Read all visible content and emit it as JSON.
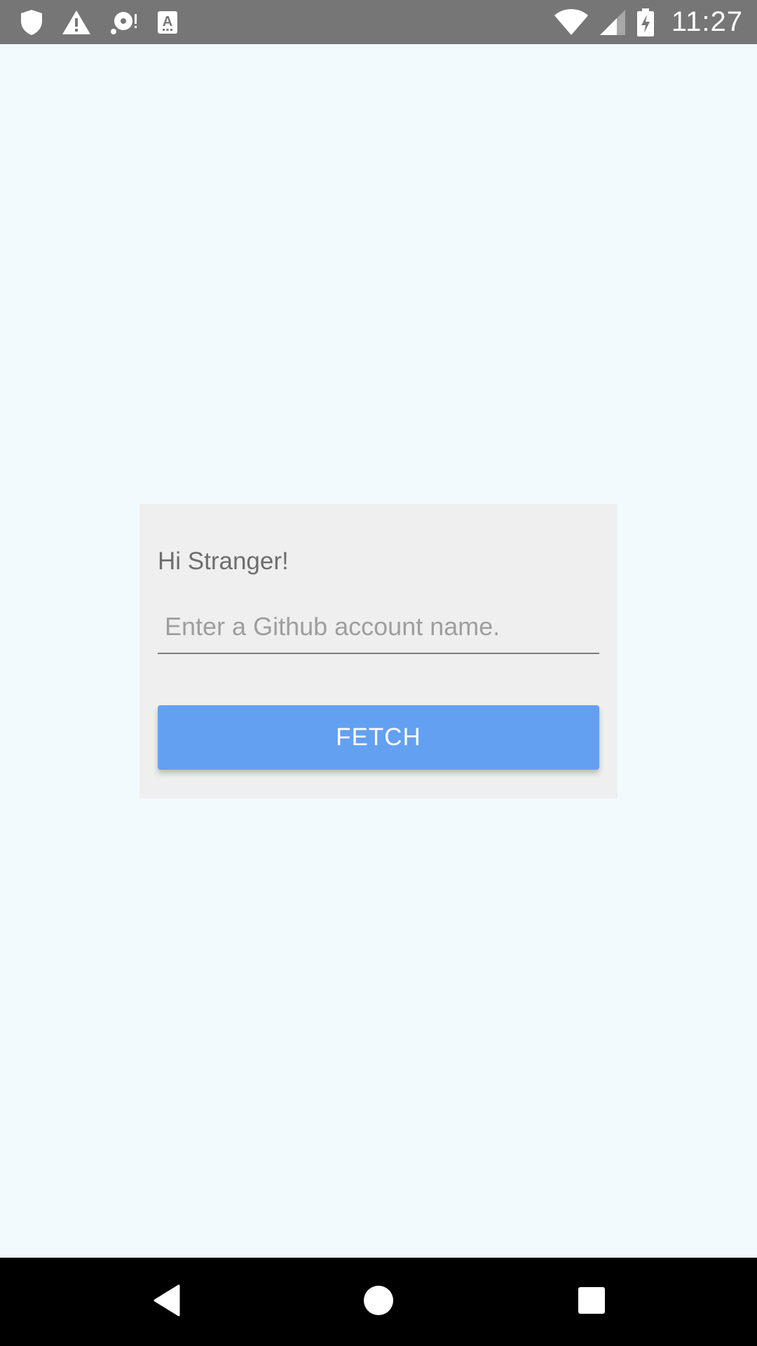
{
  "status_bar": {
    "time": "11:27",
    "left_icons": [
      "shield-icon",
      "warning-icon",
      "media-notification-icon",
      "keyboard-a-icon"
    ],
    "right_icons": [
      "wifi-icon",
      "cellular-signal-icon",
      "battery-charging-icon"
    ]
  },
  "card": {
    "greeting": "Hi Stranger!",
    "input_placeholder": "Enter a Github account name.",
    "input_value": "",
    "button_label": "FETCH"
  },
  "nav_bar": {
    "buttons": [
      "back-icon",
      "home-icon",
      "recents-icon"
    ]
  },
  "colors": {
    "status_bar": "#767676",
    "background": "#f2fafe",
    "card": "#efefef",
    "button": "#64a0f2",
    "nav_bar": "#000000"
  }
}
